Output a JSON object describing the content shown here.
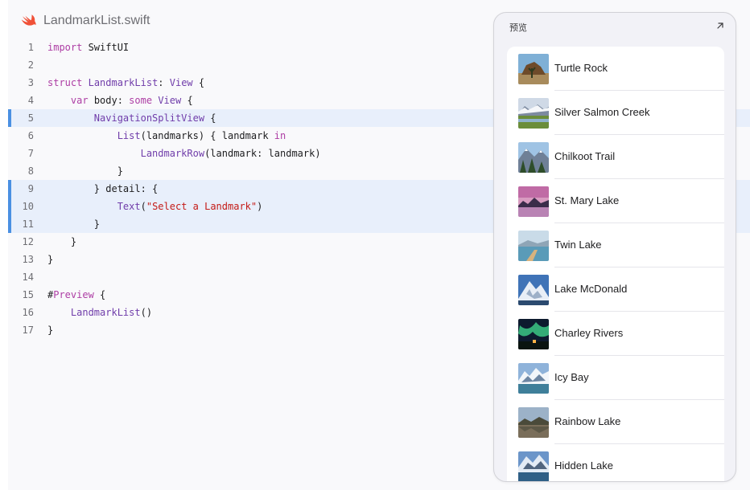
{
  "file": {
    "name": "LandmarkList.swift",
    "icon": "swift-logo-icon"
  },
  "code_lines": [
    {
      "ln": "1",
      "hl": false,
      "parts": [
        [
          "kw",
          "import"
        ],
        [
          "pl",
          " SwiftUI"
        ]
      ]
    },
    {
      "ln": "2",
      "hl": false,
      "parts": []
    },
    {
      "ln": "3",
      "hl": false,
      "parts": [
        [
          "kw",
          "struct"
        ],
        [
          "pl",
          " "
        ],
        [
          "ty",
          "LandmarkList"
        ],
        [
          "pl",
          ": "
        ],
        [
          "ty",
          "View"
        ],
        [
          "pl",
          " {"
        ]
      ]
    },
    {
      "ln": "4",
      "hl": false,
      "parts": [
        [
          "pl",
          "    "
        ],
        [
          "kw",
          "var"
        ],
        [
          "pl",
          " body: "
        ],
        [
          "kw",
          "some"
        ],
        [
          "pl",
          " "
        ],
        [
          "ty",
          "View"
        ],
        [
          "pl",
          " {"
        ]
      ]
    },
    {
      "ln": "5",
      "hl": true,
      "parts": [
        [
          "pl",
          "        "
        ],
        [
          "fn",
          "NavigationSplitView"
        ],
        [
          "pl",
          " {"
        ]
      ]
    },
    {
      "ln": "6",
      "hl": false,
      "parts": [
        [
          "pl",
          "            "
        ],
        [
          "fn",
          "List"
        ],
        [
          "pl",
          "(landmarks) { landmark "
        ],
        [
          "kw",
          "in"
        ]
      ]
    },
    {
      "ln": "7",
      "hl": false,
      "parts": [
        [
          "pl",
          "                "
        ],
        [
          "fn",
          "LandmarkRow"
        ],
        [
          "pl",
          "(landmark: landmark)"
        ]
      ]
    },
    {
      "ln": "8",
      "hl": false,
      "parts": [
        [
          "pl",
          "            }"
        ]
      ]
    },
    {
      "ln": "9",
      "hl": true,
      "parts": [
        [
          "pl",
          "        } detail: {"
        ]
      ]
    },
    {
      "ln": "10",
      "hl": true,
      "parts": [
        [
          "pl",
          "            "
        ],
        [
          "fn",
          "Text"
        ],
        [
          "pl",
          "("
        ],
        [
          "str",
          "\"Select a Landmark\""
        ],
        [
          "pl",
          ")"
        ]
      ]
    },
    {
      "ln": "11",
      "hl": true,
      "parts": [
        [
          "pl",
          "        }"
        ]
      ]
    },
    {
      "ln": "12",
      "hl": false,
      "parts": [
        [
          "pl",
          "    }"
        ]
      ]
    },
    {
      "ln": "13",
      "hl": false,
      "parts": [
        [
          "pl",
          "}"
        ]
      ]
    },
    {
      "ln": "14",
      "hl": false,
      "parts": []
    },
    {
      "ln": "15",
      "hl": false,
      "parts": [
        [
          "pl",
          "#"
        ],
        [
          "kw",
          "Preview"
        ],
        [
          "pl",
          " {"
        ]
      ]
    },
    {
      "ln": "16",
      "hl": false,
      "parts": [
        [
          "pl",
          "    "
        ],
        [
          "fn",
          "LandmarkList"
        ],
        [
          "pl",
          "()"
        ]
      ]
    },
    {
      "ln": "17",
      "hl": false,
      "parts": [
        [
          "pl",
          "}"
        ]
      ]
    }
  ],
  "preview": {
    "title": "预览",
    "expand_icon": "expand-arrow-icon",
    "landmarks": [
      {
        "name": "Turtle Rock",
        "thumb": "desert-rock"
      },
      {
        "name": "Silver Salmon Creek",
        "thumb": "creek-meadow"
      },
      {
        "name": "Chilkoot Trail",
        "thumb": "forest-mountains"
      },
      {
        "name": "St. Mary Lake",
        "thumb": "pink-sunset-lake"
      },
      {
        "name": "Twin Lake",
        "thumb": "lake-dock"
      },
      {
        "name": "Lake McDonald",
        "thumb": "snow-peak"
      },
      {
        "name": "Charley Rivers",
        "thumb": "aurora"
      },
      {
        "name": "Icy Bay",
        "thumb": "icy-mountains"
      },
      {
        "name": "Rainbow Lake",
        "thumb": "lake-reflection"
      },
      {
        "name": "Hidden Lake",
        "thumb": "alpine-lake"
      }
    ]
  },
  "colors": {
    "keyword": "#ad3da4",
    "type": "#703daa",
    "string": "#c41a16",
    "highlight": "#e8effb",
    "highlight_bar": "#4a90e2",
    "swift_orange": "#f05138"
  }
}
